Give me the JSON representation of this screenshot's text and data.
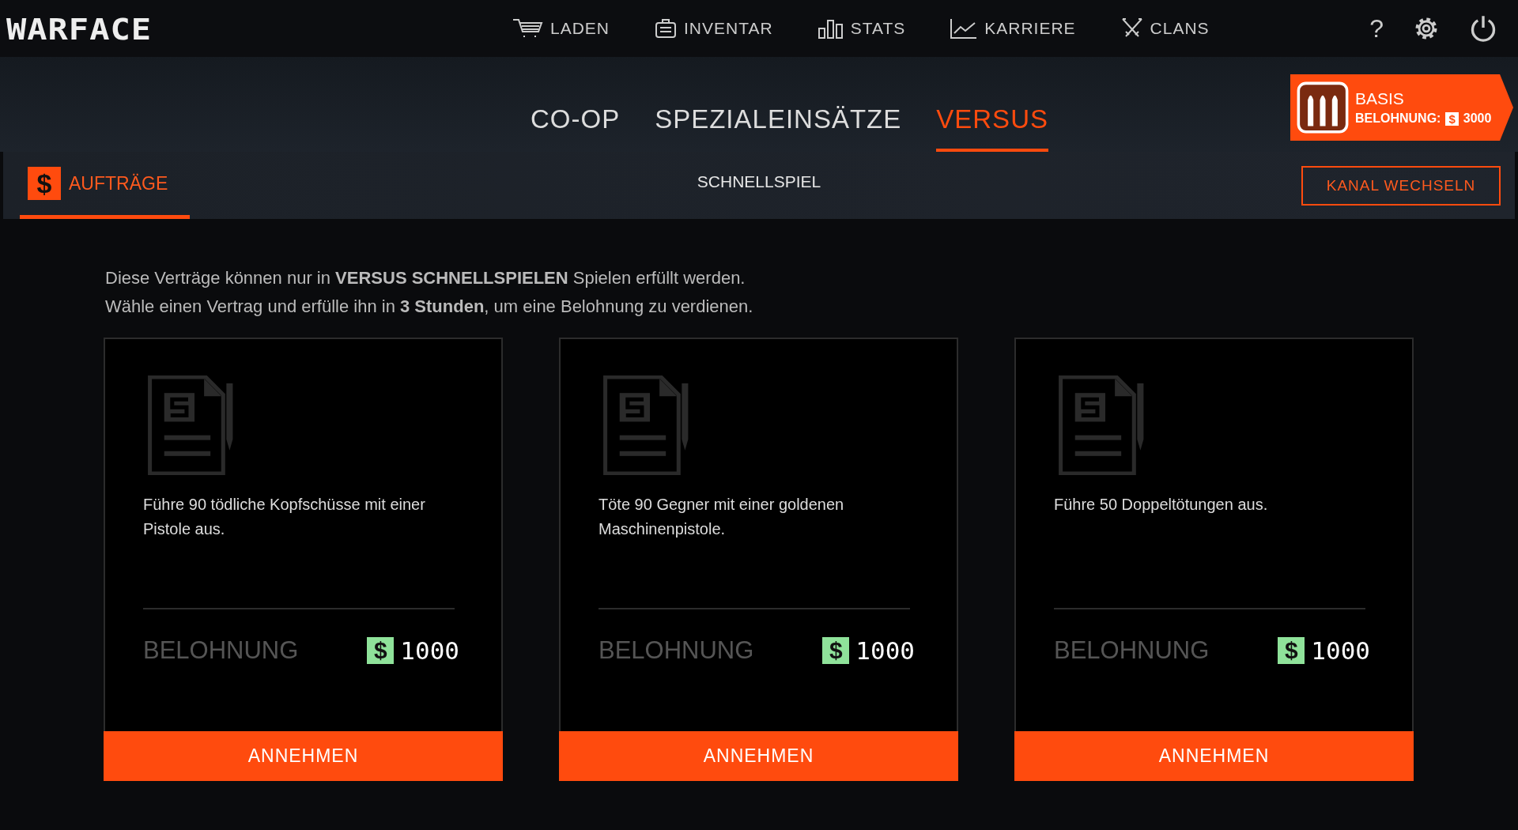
{
  "logo": "WARFACE",
  "nav": [
    {
      "label": "LADEN",
      "kind": "cart"
    },
    {
      "label": "INVENTAR",
      "kind": "case"
    },
    {
      "label": "STATS",
      "kind": "bars"
    },
    {
      "label": "KARRIERE",
      "kind": "chart"
    },
    {
      "label": "CLANS",
      "kind": "swords"
    }
  ],
  "help": "?",
  "mode_tabs": [
    {
      "label": "CO-OP",
      "selected": false
    },
    {
      "label": "SPEZIALEINSÄTZE",
      "selected": false
    },
    {
      "label": "VERSUS",
      "selected": true
    }
  ],
  "rank_badge": {
    "title": "BASIS",
    "reward_label": "BELOHNUNG:",
    "currency": "$",
    "amount": "3000"
  },
  "sub_tabs": [
    {
      "label": "AUFTRÄGE",
      "icon": "$",
      "selected": true
    }
  ],
  "channel": "SCHNELLSPIEL",
  "change_channel_button": "KANAL WECHSELN",
  "info_lines": [
    "Diese Verträge können nur in **VERSUS SCHNELLSPIELEN** Spielen erfüllt werden.",
    "Wähle einen Vertrag und erfülle ihn in **3 Stunden**, um eine Belohnung zu verdienen."
  ],
  "contracts": [
    {
      "task": "Führe 90 tödliche Kopfschüsse mit einer Pistole aus.",
      "reward_label": "BELOHNUNG",
      "currency": "$",
      "reward": "1000",
      "button": "ANNEHMEN"
    },
    {
      "task": "Töte 90 Gegner mit einer goldenen Maschinenpistole.",
      "reward_label": "BELOHNUNG",
      "currency": "$",
      "reward": "1000",
      "button": "ANNEHMEN"
    },
    {
      "task": "Führe 50 Doppeltötungen aus.",
      "reward_label": "BELOHNUNG",
      "currency": "$",
      "reward": "1000",
      "button": "ANNEHMEN"
    }
  ]
}
